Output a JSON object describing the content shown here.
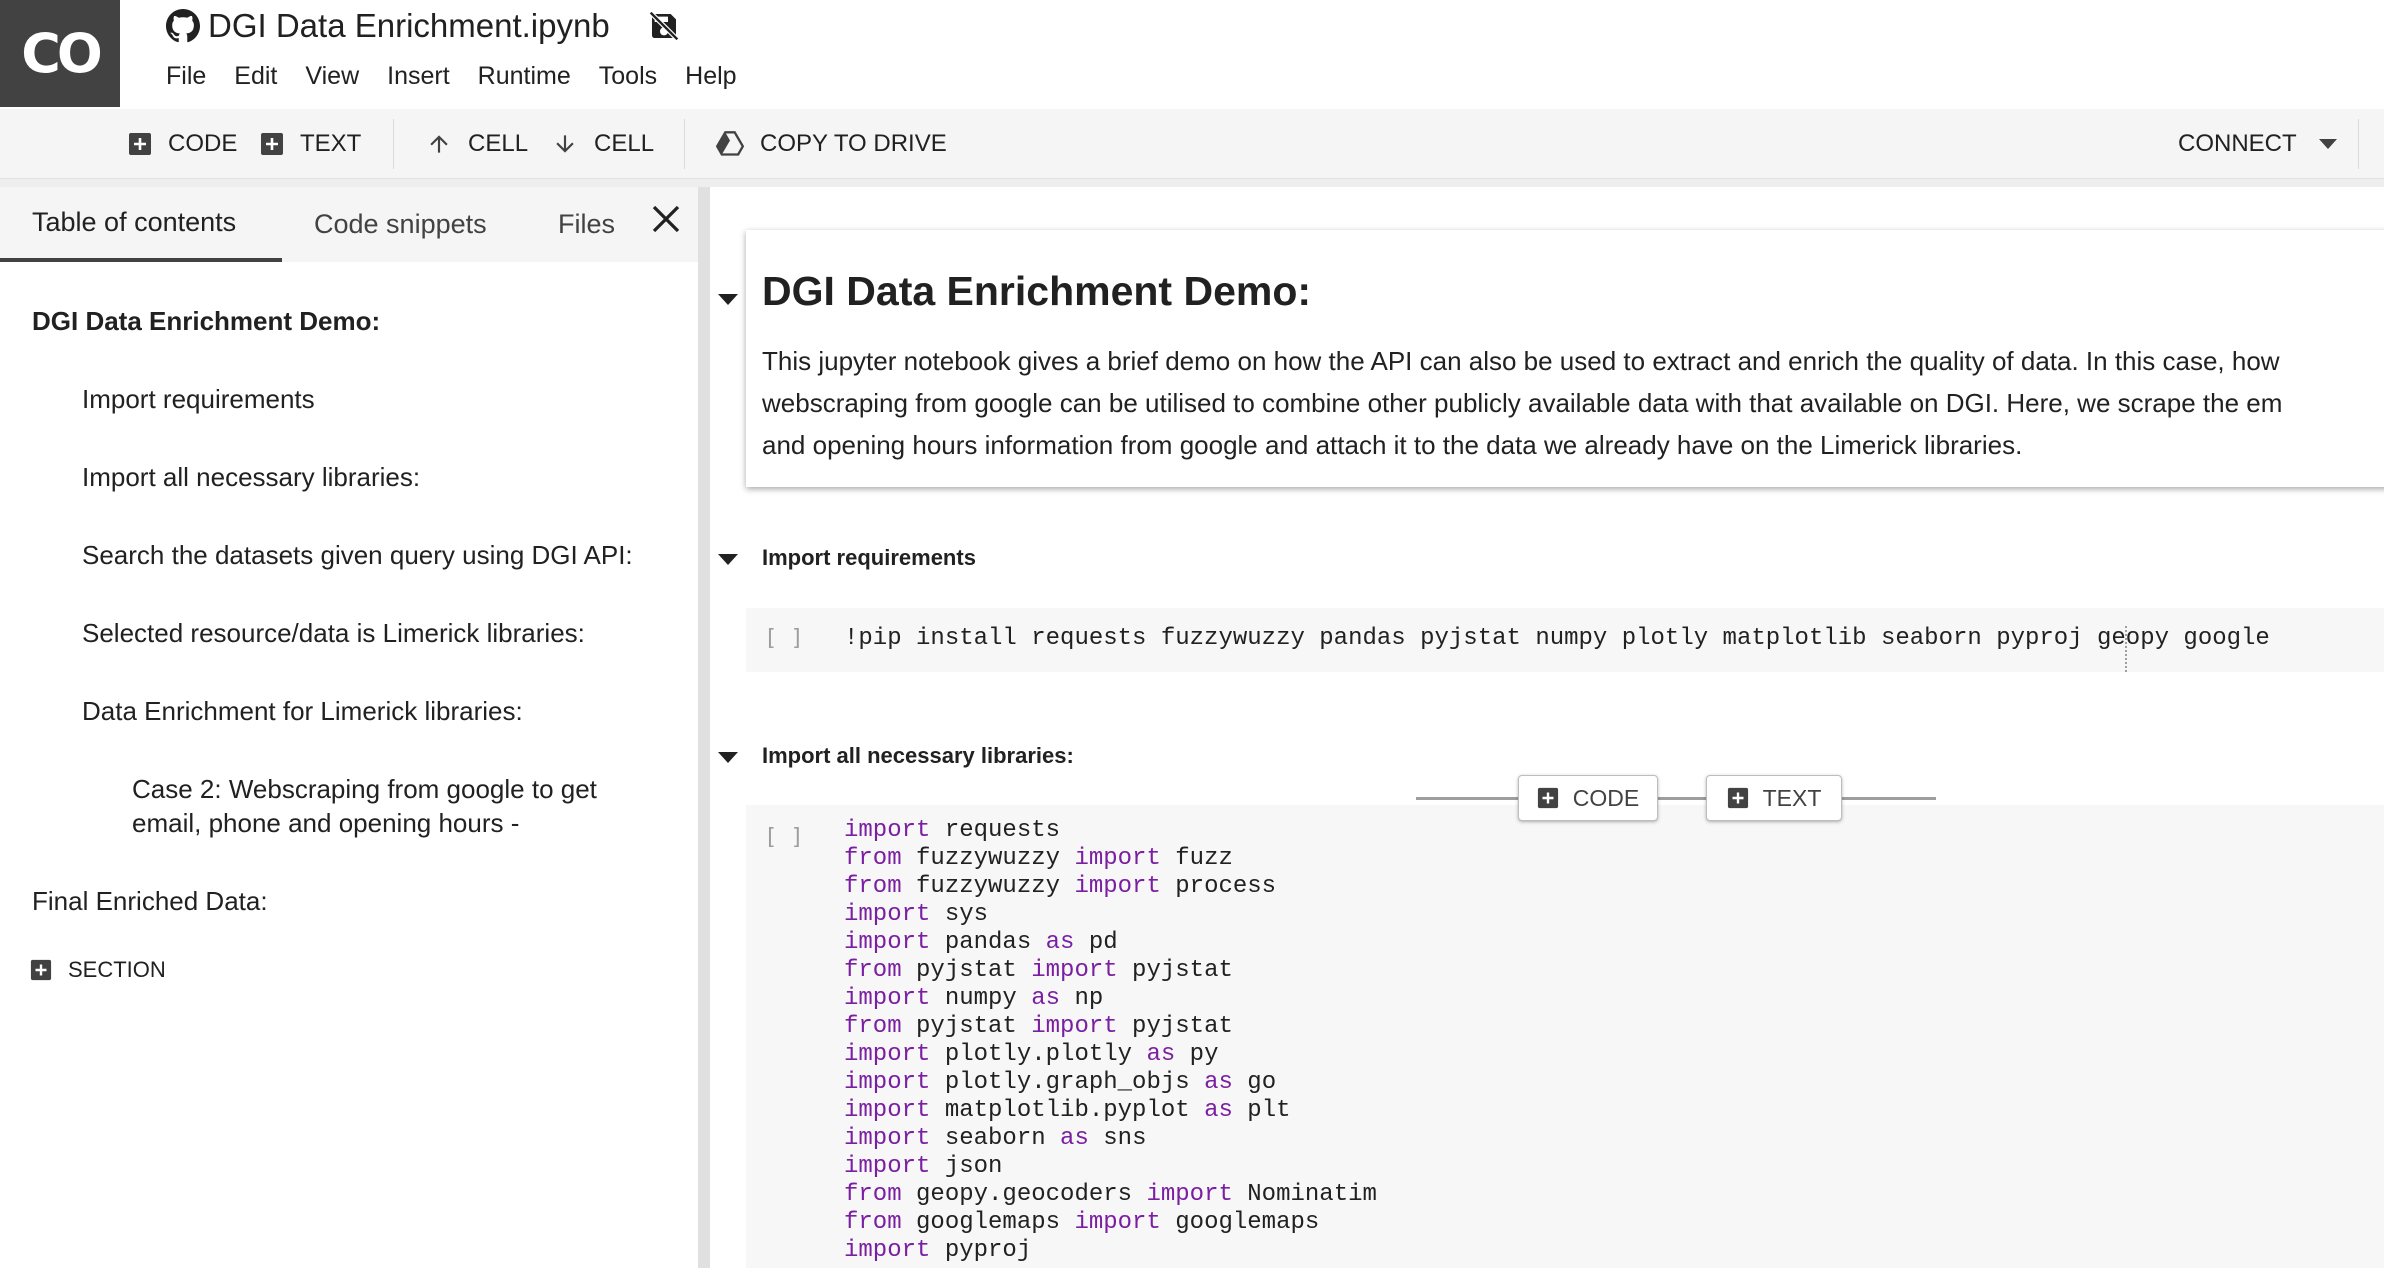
{
  "header": {
    "logo_text": "CO",
    "notebook_title": "DGI Data Enrichment.ipynb",
    "menu": [
      "File",
      "Edit",
      "View",
      "Insert",
      "Runtime",
      "Tools",
      "Help"
    ]
  },
  "toolbar": {
    "add_code": "CODE",
    "add_text": "TEXT",
    "cell_up": "CELL",
    "cell_down": "CELL",
    "copy_to_drive": "COPY TO DRIVE",
    "connect": "CONNECT"
  },
  "side_panel": {
    "tabs": [
      "Table of contents",
      "Code snippets",
      "Files"
    ],
    "toc": [
      "DGI Data Enrichment Demo:",
      "Import requirements",
      "Import all necessary libraries:",
      "Search the datasets given query using DGI API:",
      "Selected resource/data is Limerick libraries:",
      "Data Enrichment for Limerick libraries:",
      "Case 2: Webscraping from google to get",
      "email, phone and opening hours -",
      "Final Enriched Data:"
    ],
    "add_section": "SECTION"
  },
  "notebook": {
    "md_title": "DGI Data Enrichment Demo:",
    "md_lines": [
      "This jupyter notebook gives a brief demo on how the API can also be used to extract and enrich the quality of data. In this case, how",
      "webscraping from google can be utilised to combine other publicly available data with that available on DGI. Here, we scrape the em",
      "and opening hours information from google and attach it to the data we already have on the Limerick libraries."
    ],
    "section1_heading": "Import requirements",
    "run_bracket": "[ ]",
    "pip_code": "!pip install requests fuzzywuzzy pandas pyjstat numpy plotly matplotlib seaborn pyproj geopy google",
    "section2_heading": "Import all necessary libraries:",
    "add_bar": {
      "code": "CODE",
      "text": "TEXT"
    },
    "import_lines": [
      [
        {
          "k": "import"
        },
        {
          "t": " requests"
        }
      ],
      [
        {
          "k": "from"
        },
        {
          "t": " fuzzywuzzy "
        },
        {
          "k": "import"
        },
        {
          "t": " fuzz"
        }
      ],
      [
        {
          "k": "from"
        },
        {
          "t": " fuzzywuzzy "
        },
        {
          "k": "import"
        },
        {
          "t": " process"
        }
      ],
      [
        {
          "k": "import"
        },
        {
          "t": " sys"
        }
      ],
      [
        {
          "k": "import"
        },
        {
          "t": " pandas "
        },
        {
          "k": "as"
        },
        {
          "t": " pd"
        }
      ],
      [
        {
          "k": "from"
        },
        {
          "t": " pyjstat "
        },
        {
          "k": "import"
        },
        {
          "t": " pyjstat"
        }
      ],
      [
        {
          "k": "import"
        },
        {
          "t": " numpy "
        },
        {
          "k": "as"
        },
        {
          "t": " np"
        }
      ],
      [
        {
          "k": "from"
        },
        {
          "t": " pyjstat "
        },
        {
          "k": "import"
        },
        {
          "t": " pyjstat"
        }
      ],
      [
        {
          "k": "import"
        },
        {
          "t": " plotly.plotly "
        },
        {
          "k": "as"
        },
        {
          "t": " py"
        }
      ],
      [
        {
          "k": "import"
        },
        {
          "t": " plotly.graph_objs "
        },
        {
          "k": "as"
        },
        {
          "t": " go"
        }
      ],
      [
        {
          "k": "import"
        },
        {
          "t": " matplotlib.pyplot "
        },
        {
          "k": "as"
        },
        {
          "t": " plt"
        }
      ],
      [
        {
          "k": "import"
        },
        {
          "t": " seaborn "
        },
        {
          "k": "as"
        },
        {
          "t": " sns"
        }
      ],
      [
        {
          "k": "import"
        },
        {
          "t": " json"
        }
      ],
      [
        {
          "k": "from"
        },
        {
          "t": " geopy.geocoders "
        },
        {
          "k": "import"
        },
        {
          "t": " Nominatim"
        }
      ],
      [
        {
          "k": "from"
        },
        {
          "t": " googlemaps "
        },
        {
          "k": "import"
        },
        {
          "t": " googlemaps"
        }
      ],
      [
        {
          "k": "import"
        },
        {
          "t": " pyproj"
        }
      ]
    ]
  }
}
